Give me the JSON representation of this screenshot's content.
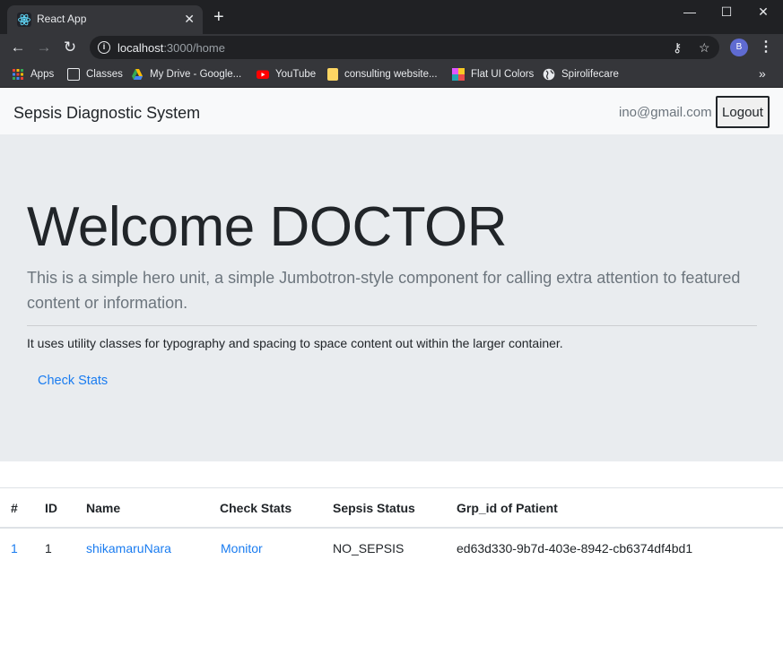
{
  "browser": {
    "tab_title": "React App",
    "url_host": "localhost",
    "url_path": ":3000/home",
    "profile_initial": "B",
    "bookmarks": [
      {
        "label": "Apps",
        "icon": "apps-grid-icon",
        "color": "#ea4335"
      },
      {
        "label": "Classes",
        "icon": "classes-icon",
        "color": "#e8eaed"
      },
      {
        "label": "My Drive - Google...",
        "icon": "google-drive-icon",
        "color": "#fbbc04"
      },
      {
        "label": "YouTube",
        "icon": "youtube-icon",
        "color": "#ff0000"
      },
      {
        "label": "consulting website...",
        "icon": "folder-icon",
        "color": "#fdd663"
      },
      {
        "label": "Flat UI Colors",
        "icon": "flat-ui-colors-icon",
        "color": "#e056fd"
      },
      {
        "label": "Spirolifecare",
        "icon": "globe-icon",
        "color": "#e8eaed"
      }
    ]
  },
  "navbar": {
    "brand": "Sepsis Diagnostic System",
    "user_email": "ino@gmail.com",
    "logout_label": "Logout"
  },
  "jumbotron": {
    "title": "Welcome DOCTOR",
    "lead": "This is a simple hero unit, a simple Jumbotron-style component for calling extra attention to featured content or information.",
    "text": "It uses utility classes for typography and spacing to space content out within the larger container.",
    "link_label": "Check Stats"
  },
  "table": {
    "headers": [
      "#",
      "ID",
      "Name",
      "Check Stats",
      "Sepsis Status",
      "Grp_id of Patient"
    ],
    "rows": [
      {
        "index": "1",
        "id": "1",
        "name": "shikamaruNara",
        "check_stats": "Monitor",
        "sepsis_status": "NO_SEPSIS",
        "grp_id": "ed63d330-9b7d-403e-8942-cb6374df4bd1"
      }
    ]
  },
  "colors": {
    "link": "#1a7cf0",
    "jumbotron_bg": "#e9ecef",
    "navbar_bg": "#f8f9fa",
    "chrome_dark": "#202124",
    "chrome_toolbar": "#35363a"
  }
}
